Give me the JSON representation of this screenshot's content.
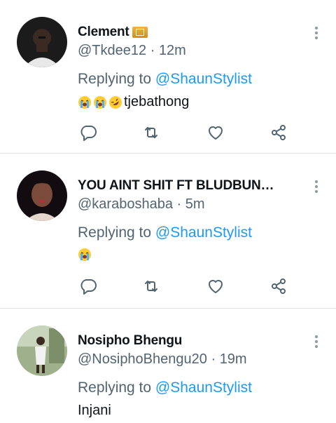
{
  "tweets": [
    {
      "name": "Clement",
      "badge_icon": "money-bag-icon",
      "handle": "@Tkdee12",
      "time": "12m",
      "replying_label": "Replying to",
      "mention": "@ShaunStylist",
      "emojis": [
        "loudly-crying-face",
        "loudly-crying-face",
        "rolling-on-floor-laughing"
      ],
      "text": "tjebathong"
    },
    {
      "name": "YOU AINT SHIT FT BLUDBUN…",
      "handle": "@karaboshaba",
      "time": "5m",
      "replying_label": "Replying to",
      "mention": "@ShaunStylist",
      "emojis": [
        "loudly-crying-face"
      ],
      "text": ""
    },
    {
      "name": "Nosipho Bhengu",
      "handle": "@NosiphoBhengu20",
      "time": "19m",
      "replying_label": "Replying to",
      "mention": "@ShaunStylist",
      "emojis": [],
      "text": "Injani"
    }
  ],
  "separator": "·",
  "colors": {
    "mention": "#1d9bf0",
    "secondary_text": "#536471",
    "icon": "#536471",
    "divider": "#dfe3e6"
  }
}
